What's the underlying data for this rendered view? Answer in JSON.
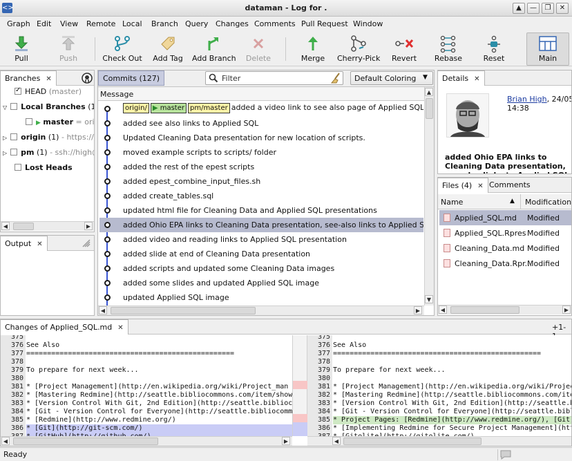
{
  "window": {
    "title": "dataman - Log for .",
    "app_icon": "app-icon",
    "buttons": [
      "▲",
      "—",
      "❐",
      "✕"
    ]
  },
  "menu": [
    "Graph",
    "Edit",
    "View",
    "Remote",
    "Local",
    "Branch",
    "Query",
    "Changes",
    "Comments",
    "Pull Request",
    "Window"
  ],
  "toolbar": {
    "pull": "Pull",
    "push": "Push",
    "checkout": "Check Out",
    "add_tag": "Add Tag",
    "add_branch": "Add Branch",
    "delete": "Delete",
    "merge": "Merge",
    "cherry_pick": "Cherry-Pick",
    "revert": "Revert",
    "rebase": "Rebase",
    "reset": "Reset",
    "main": "Main"
  },
  "branches": {
    "tab_label": "Branches",
    "head": "HEAD",
    "head_detail": "(master)",
    "local_branches": "Local Branches",
    "local_count": "(1)",
    "master": "master",
    "master_detail": "= orig",
    "origin": "origin",
    "origin_count": "(1)",
    "origin_url": "- https://gi",
    "pm": "pm",
    "pm_count": "(1)",
    "pm_url": "- ssh://high@",
    "lost_heads": "Lost Heads"
  },
  "output": {
    "tab_label": "Output"
  },
  "commits": {
    "tab_label": "Commits (127)",
    "filter_placeholder": "Filter",
    "coloring": "Default Coloring",
    "column_header": "Message",
    "refs": {
      "origin": "origin/",
      "master": "master",
      "pm": "pm/master"
    },
    "rows": [
      "added a video link to see also page of Applied SQL presentation",
      "added see also links to Applied SQL",
      "Updated Cleaning Data presentation for new location of scripts.",
      "moved example scripts to scripts/ folder",
      "added the rest of the epest scripts",
      "added epest_combine_input_files.sh",
      "added create_tables.sql",
      "updated html file for Cleaning Data and Applied SQL presentations",
      "added Ohio EPA links to Cleaning Data presentation, see-also links to Applied SQL presentation",
      "added video and reading links to Applied SQL presentation",
      "added slide at end of Cleaning Data presentation",
      "added scripts and updated some Cleaning Data images",
      "added some slides and updated Applied SQL image",
      "updated Applied SQL image"
    ]
  },
  "details": {
    "tab_label": "Details",
    "author": "Brian High",
    "date": ", 24/05/20",
    "time": "14:38",
    "message": "added Ohio EPA links to Cleaning Data presentation, see-also links to Applied SQL presentation"
  },
  "files": {
    "tab_label": "Files (4)",
    "comments_tab": "Comments",
    "col_name": "Name",
    "col_mod": "Modification",
    "rows": [
      {
        "name": "Applied_SQL.md",
        "mod": "Modified"
      },
      {
        "name": "Applied_SQL.Rpres",
        "mod": "Modified"
      },
      {
        "name": "Cleaning_Data.md",
        "mod": "Modified"
      },
      {
        "name": "Cleaning_Data.Rpr...",
        "mod": "Modified"
      }
    ]
  },
  "changes": {
    "tab_label": "Changes of Applied_SQL.md",
    "counter": "+1-1~",
    "left": [
      {
        "n": "375",
        "t": ""
      },
      {
        "n": "376",
        "t": "See Also"
      },
      {
        "n": "377",
        "t": "=================================================="
      },
      {
        "n": "378",
        "t": ""
      },
      {
        "n": "379",
        "t": "To prepare for next week..."
      },
      {
        "n": "380",
        "t": ""
      },
      {
        "n": "381",
        "t": "* [Project Management](http://en.wikipedia.org/wiki/Project_man"
      },
      {
        "n": "382",
        "t": "* [Mastering Redmine](http://seattle.bibliocommons.com/item/show"
      },
      {
        "n": "383",
        "t": "* [Version Control With Git, 2nd Edition](http://seattle.biblioc"
      },
      {
        "n": "384",
        "t": "* [Git - Version Control for Everyone](http://seattle.bibliocomm"
      },
      {
        "n": "385",
        "t": "* [Redmine](http://www.redmine.org/)"
      },
      {
        "n": "386",
        "t": "* [Git](http://git-scm.com/)"
      },
      {
        "n": "387",
        "t": "* [GitHub](http://github.com/)"
      }
    ],
    "right": [
      {
        "n": "375",
        "t": ""
      },
      {
        "n": "376",
        "t": "See Also"
      },
      {
        "n": "377",
        "t": "=================================================="
      },
      {
        "n": "378",
        "t": ""
      },
      {
        "n": "379",
        "t": "To prepare for next week..."
      },
      {
        "n": "380",
        "t": ""
      },
      {
        "n": "381",
        "t": "* [Project Management](http://en.wikipedia.org/wiki/Project_mana"
      },
      {
        "n": "382",
        "t": "* [Mastering Redmine](http://seattle.bibliocommons.com/item/show"
      },
      {
        "n": "383",
        "t": "* [Version Control With Git, 2nd Edition](http://seattle.biblioc"
      },
      {
        "n": "384",
        "t": "* [Git - Version Control for Everyone](http://seattle.bibliocomm"
      },
      {
        "n": "385",
        "t": "* Project Pages: [Redmine](http://www.redmine.org/), [Git](http"
      },
      {
        "n": "386",
        "t": "* [Implementing Redmine for Secure Project Management](http://se"
      },
      {
        "n": "387",
        "t": "* [Gitolite](http://gitolite.com/)"
      }
    ]
  },
  "status": {
    "text": "Ready"
  },
  "colors": {
    "selection": "#b7bbcf",
    "graph_line": "#3a56d4",
    "ref_remote": "#fff6a8",
    "ref_local": "#b7e39c",
    "diff_changed": "#f8c6c6",
    "diff_added": "#cfe9c4",
    "diff_moved": "#c9ccf6"
  }
}
